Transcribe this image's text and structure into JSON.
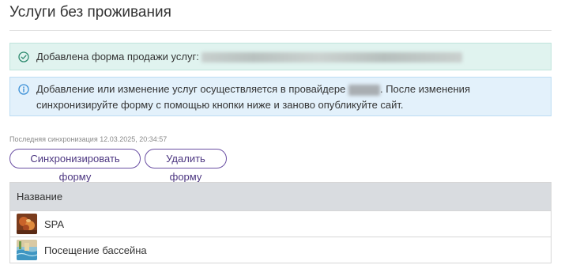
{
  "page": {
    "title": "Услуги без проживания"
  },
  "alerts": {
    "success": {
      "text": "Добавлена форма продажи услуг:",
      "icon": "check-circle-icon",
      "color": "#2e8b6f"
    },
    "info": {
      "text_before": "Добавление или изменение услуг осуществляется в провайдере",
      "text_after": ". После изменения синхронизируйте форму с помощью кнопки ниже и заново опубликуйте сайт.",
      "icon": "info-circle-icon",
      "color": "#3a8fd6"
    }
  },
  "sync": {
    "last_sync": "Последняя синхронизация 12.03.2025, 20:34:57"
  },
  "buttons": {
    "sync_label": "Синхронизировать форму",
    "delete_label": "Удалить форму",
    "accent": "#6a4fa3"
  },
  "table": {
    "header": "Название",
    "rows": [
      {
        "name": "SPA",
        "icon": "spa-thumbnail"
      },
      {
        "name": "Посещение бассейна",
        "icon": "pool-thumbnail"
      }
    ]
  }
}
